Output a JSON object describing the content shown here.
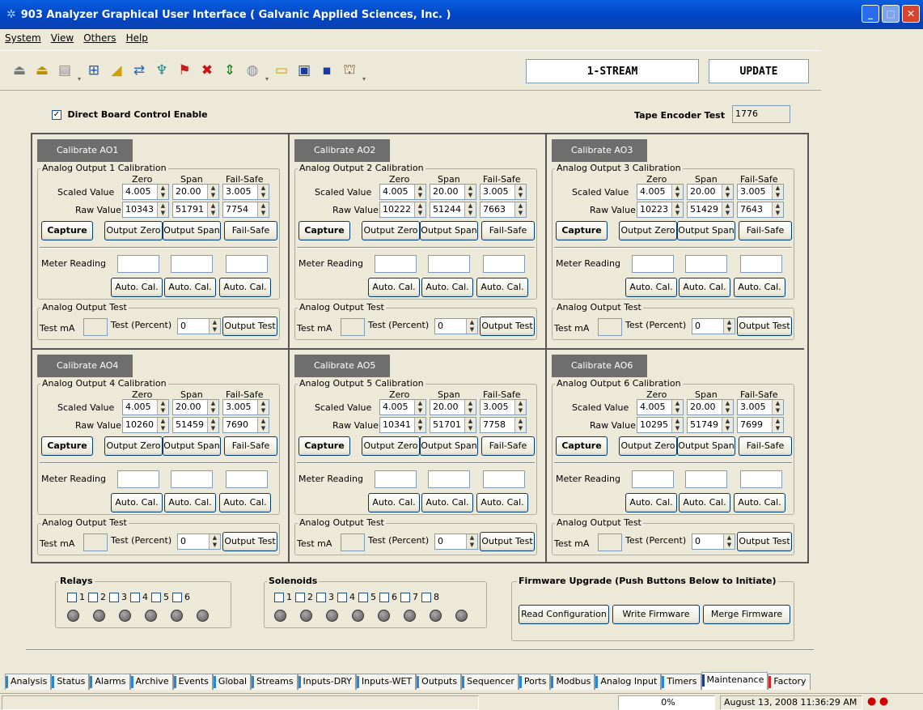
{
  "window": {
    "title": "903 Analyzer Graphical User Interface  ( Galvanic Applied Sciences, Inc. )"
  },
  "menu": [
    "System",
    "View",
    "Others",
    "Help"
  ],
  "toolbar": {
    "stream_label": "1-STREAM",
    "update_label": "UPDATE"
  },
  "direct_board": "Direct Board Control Enable",
  "tape_encoder": {
    "label": "Tape Encoder Test",
    "value": "1776"
  },
  "common": {
    "zero": "Zero",
    "span": "Span",
    "failsafe": "Fail-Safe",
    "scaled": "Scaled Value",
    "raw": "Raw Value",
    "capture": "Capture",
    "output_zero": "Output Zero",
    "output_span": "Output Span",
    "fail_safe_btn": "Fail-Safe",
    "meter": "Meter Reading",
    "auto_cal": "Auto. Cal.",
    "test_title": "Analog Output Test",
    "test_ma": "Test mA",
    "test_percent": "Test (Percent)",
    "output_test": "Output Test"
  },
  "panels": [
    {
      "title": "Calibrate AO1",
      "legend": "Analog Output 1 Calibration",
      "scaled": [
        "4.005",
        "20.00",
        "3.005"
      ],
      "raw": [
        "10343",
        "51791",
        "7754"
      ],
      "pct": "0"
    },
    {
      "title": "Calibrate AO2",
      "legend": "Analog Output 2 Calibration",
      "scaled": [
        "4.005",
        "20.00",
        "3.005"
      ],
      "raw": [
        "10222",
        "51244",
        "7663"
      ],
      "pct": "0"
    },
    {
      "title": "Calibrate AO3",
      "legend": "Analog Output 3 Calibration",
      "scaled": [
        "4.005",
        "20.00",
        "3.005"
      ],
      "raw": [
        "10223",
        "51429",
        "7643"
      ],
      "pct": "0"
    },
    {
      "title": "Calibrate AO4",
      "legend": "Analog Output 4 Calibration",
      "scaled": [
        "4.005",
        "20.00",
        "3.005"
      ],
      "raw": [
        "10260",
        "51459",
        "7690"
      ],
      "pct": "0"
    },
    {
      "title": "Calibrate AO5",
      "legend": "Analog Output 5 Calibration",
      "scaled": [
        "4.005",
        "20.00",
        "3.005"
      ],
      "raw": [
        "10341",
        "51701",
        "7758"
      ],
      "pct": "0"
    },
    {
      "title": "Calibrate AO6",
      "legend": "Analog Output 6 Calibration",
      "scaled": [
        "4.005",
        "20.00",
        "3.005"
      ],
      "raw": [
        "10295",
        "51749",
        "7699"
      ],
      "pct": "0"
    }
  ],
  "relays": {
    "title": "Relays",
    "items": [
      "1",
      "2",
      "3",
      "4",
      "5",
      "6"
    ]
  },
  "solenoids": {
    "title": "Solenoids",
    "items": [
      "1",
      "2",
      "3",
      "4",
      "5",
      "6",
      "7",
      "8"
    ]
  },
  "firmware": {
    "title": "Firmware Upgrade (Push Buttons Below to Initiate)",
    "buttons": [
      "Read Configuration",
      "Write Firmware",
      "Merge Firmware"
    ]
  },
  "tabs": [
    "Analysis",
    "Status",
    "Alarms",
    "Archive",
    "Events",
    "Global",
    "Streams",
    "Inputs-DRY",
    "Inputs-WET",
    "Outputs",
    "Sequencer",
    "Ports",
    "Modbus",
    "Analog Input",
    "Timers",
    "Maintenance",
    "Factory"
  ],
  "status": {
    "progress": "0%",
    "datetime": "August 13, 2008 11:36:29 AM"
  },
  "colors": {
    "title_bar": "#0047c8",
    "tab_marker": "#2288dd",
    "factory_marker": "#dd2222"
  }
}
